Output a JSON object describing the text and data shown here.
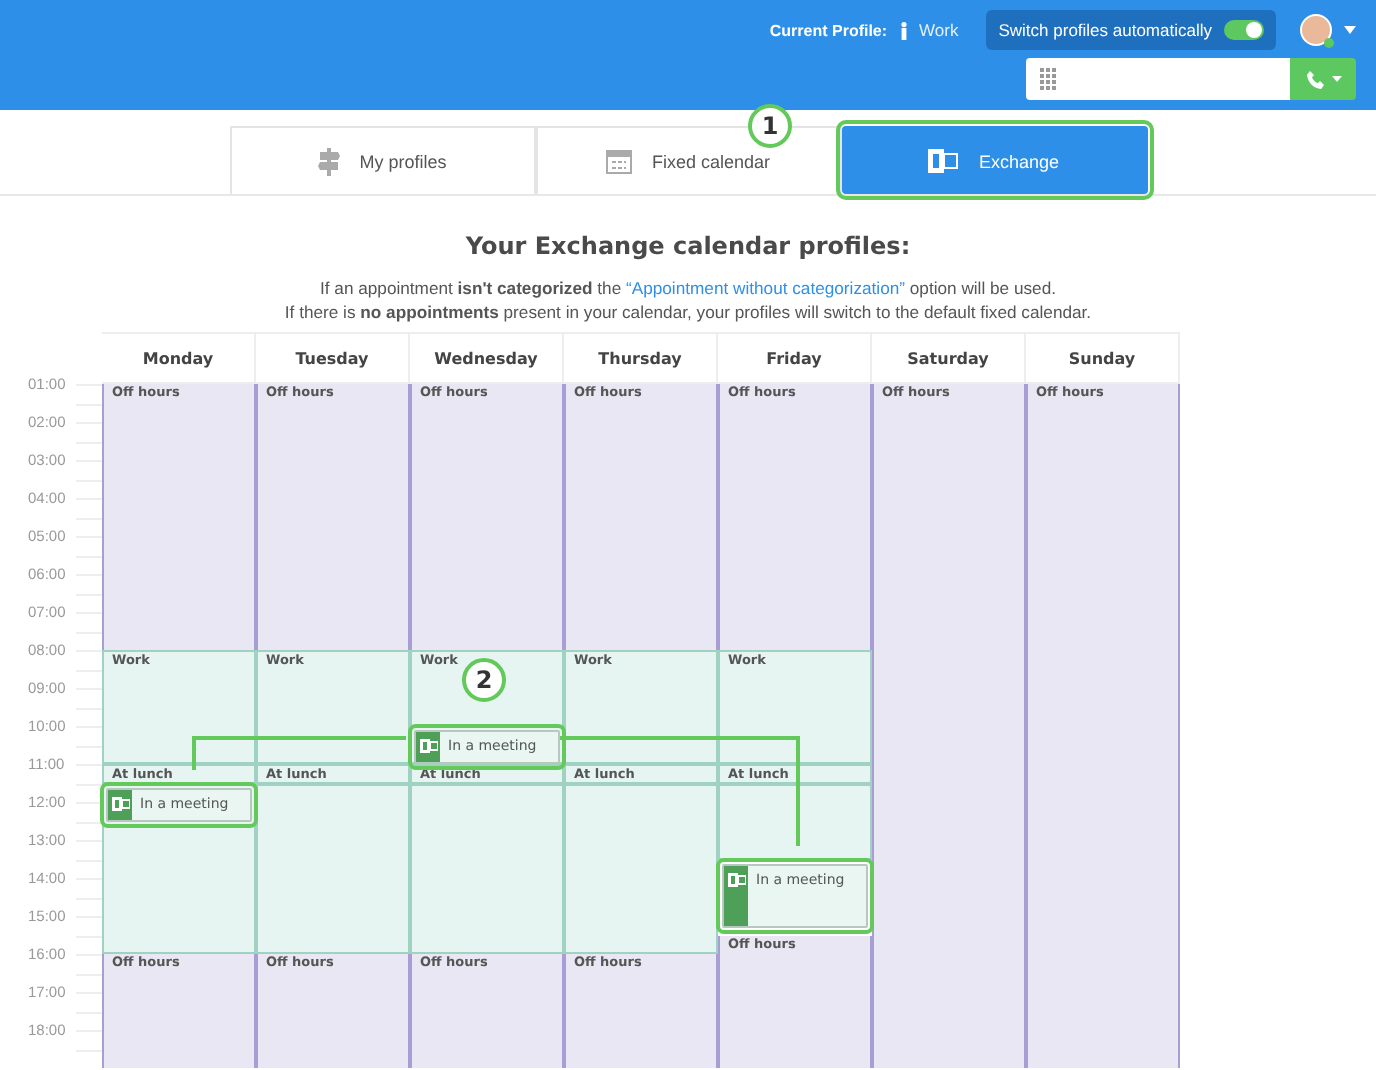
{
  "header": {
    "current_profile_label": "Current Profile:",
    "current_profile": "Work",
    "switch": {
      "label": "Switch profiles automatically",
      "on": true
    }
  },
  "tabs": [
    {
      "label": "My profiles",
      "selected": false
    },
    {
      "label": "Fixed calendar",
      "selected": false
    },
    {
      "label": "Exchange",
      "selected": true
    }
  ],
  "callouts": [
    {
      "label": "1"
    },
    {
      "label": "2"
    }
  ],
  "title": "Your Exchange calendar profiles:",
  "notice": {
    "before": "If an appointment **isn't categorized** the",
    "link": "“Appointment without categorization”",
    "after": "option will be used.",
    "line_2": "If there is **no appointments** present in your calendar, your profiles will switch to the default fixed calendar."
  },
  "hours": [
    "01:00",
    "02:00",
    "03:00",
    "04:00",
    "05:00",
    "06:00",
    "07:00",
    "08:00",
    "09:00",
    "10:00",
    "11:00",
    "12:00",
    "13:00",
    "14:00",
    "15:00",
    "16:00",
    "17:00",
    "18:00"
  ],
  "days": [
    {
      "name": "Monday",
      "segments": [
        {
          "kind": "off",
          "label": "Off hours"
        },
        {
          "kind": "work",
          "label": "Work"
        },
        {
          "kind": "work",
          "label": "At lunch"
        },
        {
          "kind": "meeting",
          "label": "In a meeting",
          "highlighted": true
        },
        {
          "kind": "work"
        },
        {
          "kind": "off",
          "label": "Off hours"
        }
      ]
    },
    {
      "name": "Tuesday",
      "segments": [
        {
          "kind": "off",
          "label": "Off hours"
        },
        {
          "kind": "work",
          "label": "Work"
        },
        {
          "kind": "work",
          "label": "At lunch"
        },
        {
          "kind": "work"
        },
        {
          "kind": "off",
          "label": "Off hours"
        }
      ]
    },
    {
      "name": "Wednesday",
      "segments": [
        {
          "kind": "off",
          "label": "Off hours"
        },
        {
          "kind": "work",
          "label": "Work"
        },
        {
          "kind": "meeting",
          "label": "In a meeting",
          "highlighted": true
        },
        {
          "kind": "work",
          "label": "At lunch"
        },
        {
          "kind": "work"
        },
        {
          "kind": "off",
          "label": "Off hours"
        }
      ]
    },
    {
      "name": "Thursday",
      "segments": [
        {
          "kind": "off",
          "label": "Off hours"
        },
        {
          "kind": "work",
          "label": "Work"
        },
        {
          "kind": "work",
          "label": "At lunch"
        },
        {
          "kind": "work"
        },
        {
          "kind": "off",
          "label": "Off hours"
        }
      ]
    },
    {
      "name": "Friday",
      "segments": [
        {
          "kind": "off",
          "label": "Off hours"
        },
        {
          "kind": "work",
          "label": "Work"
        },
        {
          "kind": "work",
          "label": "At lunch"
        },
        {
          "kind": "work"
        },
        {
          "kind": "meeting",
          "label": "In a meeting",
          "highlighted": true
        },
        {
          "kind": "off",
          "label": "Off hours"
        }
      ]
    },
    {
      "name": "Saturday",
      "segments": [
        {
          "kind": "off",
          "label": "Off hours"
        }
      ]
    },
    {
      "name": "Sunday",
      "segments": [
        {
          "kind": "off",
          "label": "Off hours"
        }
      ]
    }
  ]
}
